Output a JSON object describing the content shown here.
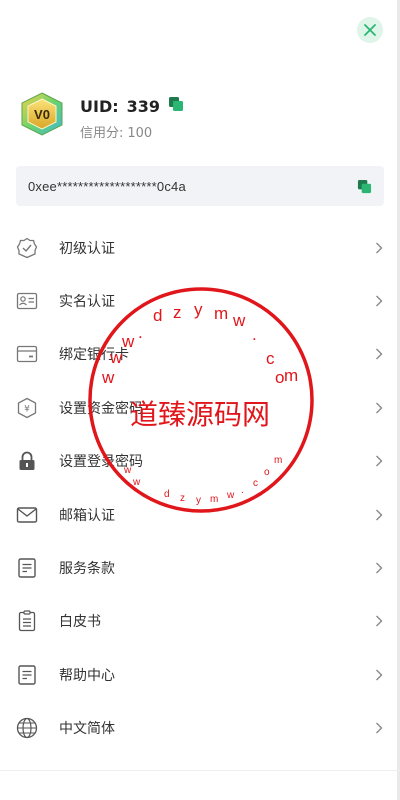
{
  "header": {
    "close_icon": "close-icon"
  },
  "profile": {
    "badge_text": "V0",
    "uid_label": "UID:",
    "uid_value": "339",
    "credit_label": "信用分:",
    "credit_value": "100"
  },
  "wallet": {
    "address": "0xee*******************0c4a"
  },
  "menu": {
    "items": [
      {
        "label": "初级认证",
        "icon": "verified-badge-icon"
      },
      {
        "label": "实名认证",
        "icon": "id-card-icon"
      },
      {
        "label": "绑定银行卡",
        "icon": "bank-card-icon"
      },
      {
        "label": "设置资金密码",
        "icon": "fund-shield-icon"
      },
      {
        "label": "设置登录密码",
        "icon": "lock-icon"
      },
      {
        "label": "邮箱认证",
        "icon": "mail-icon"
      },
      {
        "label": "服务条款",
        "icon": "document-icon"
      },
      {
        "label": "白皮书",
        "icon": "whitepaper-icon"
      },
      {
        "label": "帮助中心",
        "icon": "help-document-icon"
      },
      {
        "label": "中文简体",
        "icon": "globe-icon"
      }
    ]
  },
  "watermark": {
    "main_text": "道臻源码网",
    "ring_text": "wwwdzymw.com"
  },
  "colors": {
    "accent": "#2bb673",
    "stamp": "#e0161b"
  }
}
